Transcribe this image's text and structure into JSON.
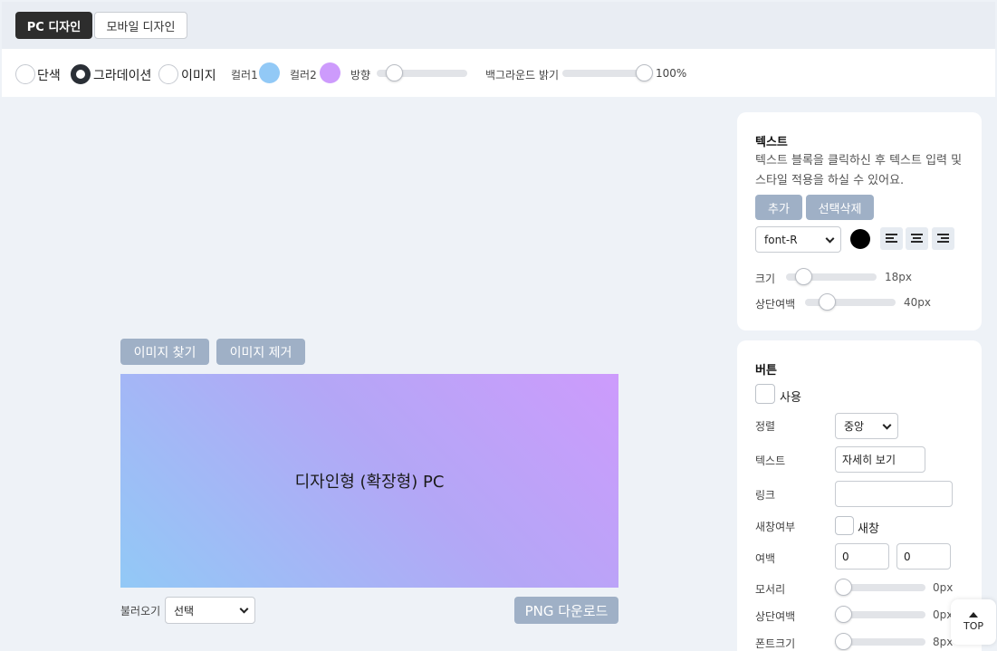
{
  "tabs": {
    "pc": "PC 디자인",
    "mobile": "모바일 디자인"
  },
  "background": {
    "options": [
      "단색",
      "그라데이션",
      "이미지"
    ],
    "selected": "그라데이션",
    "color1_label": "컬러1",
    "color1": "#92c9f6",
    "color2_label": "컬러2",
    "color2": "#cd9bfc",
    "direction_label": "방향",
    "direction_value": 0.15,
    "brightness_label": "백그라운드 밝기",
    "brightness_value": "100%"
  },
  "image_controls": {
    "find": "이미지 찾기",
    "remove": "이미지 제거"
  },
  "canvas": {
    "text": "디자인형 (확장형) PC"
  },
  "footer": {
    "load_label": "불러오기",
    "load_selected": "선택",
    "png_download": "PNG 다운로드"
  },
  "text_panel": {
    "title": "텍스트",
    "description": "텍스트 블록을 클릭하신 후 텍스트 입력 및 스타일 적용을 하실 수 있어요.",
    "add": "추가",
    "delete_selected": "선택삭제",
    "font_selected": "font-R",
    "text_color": "#000000",
    "size_label": "크기",
    "size_value": "18px",
    "top_margin_label": "상단여백",
    "top_margin_value": "40px"
  },
  "button_panel": {
    "title": "버튼",
    "use_label": "사용",
    "align_label": "정렬",
    "align_selected": "중앙",
    "text_label": "텍스트",
    "text_value": "자세히 보기",
    "link_label": "링크",
    "link_value": "",
    "new_window_label": "새창여부",
    "new_window_option": "새창",
    "margin_label": "여백",
    "margin_value_1": "0",
    "margin_value_2": "0",
    "radius_label": "모서리",
    "radius_value": "0px",
    "top_margin_label": "상단여백",
    "top_margin_value": "0px",
    "font_size_label": "폰트크기",
    "font_size_value": "8px"
  },
  "top_button": "TOP"
}
